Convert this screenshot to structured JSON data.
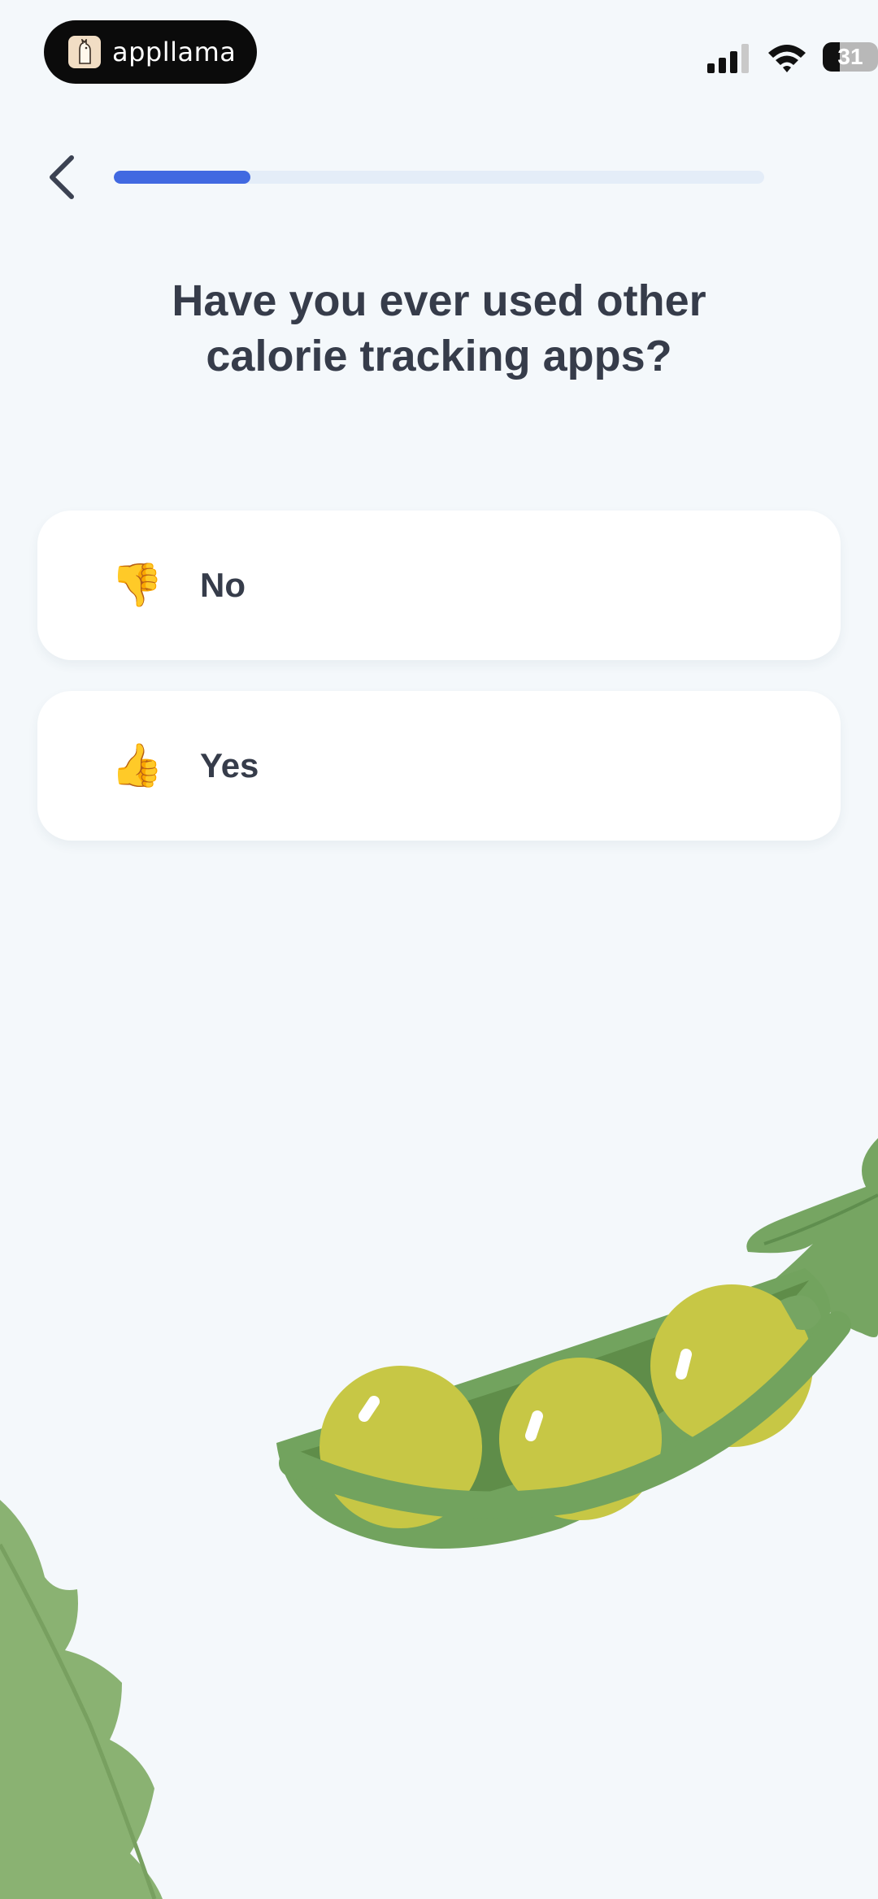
{
  "status_bar": {
    "app_name": "appllama",
    "battery": "31",
    "battery_level": 0.31,
    "icons": [
      "signal-icon",
      "wifi-icon",
      "battery-icon"
    ]
  },
  "nav": {
    "back_icon": "chevron-left-icon",
    "progress": 0.21
  },
  "question": {
    "line1": "Have you ever used other",
    "line2": "calorie tracking apps?"
  },
  "options": [
    {
      "icon": "👎",
      "icon_name": "thumbs-down-icon",
      "label": "No"
    },
    {
      "icon": "👍",
      "icon_name": "thumbs-up-icon",
      "label": "Yes"
    }
  ],
  "colors": {
    "background": "#f4f8fb",
    "accent": "#4169e1",
    "text": "#363c4a",
    "card": "#ffffff",
    "pea_pod": "#6fa05a",
    "pea": "#c5c545"
  }
}
